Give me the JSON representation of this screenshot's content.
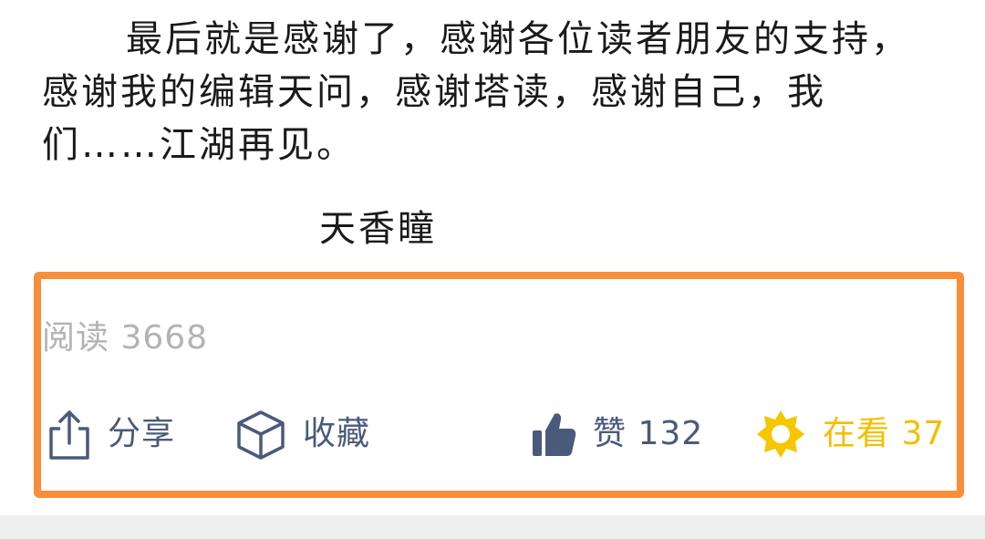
{
  "article": {
    "paragraph": "最后就是感谢了，感谢各位读者朋友的支持，感谢我的编辑天问，感谢塔读，感谢自己，我们……江湖再见。",
    "signature": "天香瞳"
  },
  "stats": {
    "read_label": "阅读 3668"
  },
  "actions": {
    "share_label": "分享",
    "collect_label": "收藏",
    "like_label": "赞 132",
    "watching_label": "在看 37"
  },
  "icons": {
    "share": "share-icon",
    "collect": "cube-icon",
    "like": "thumbs-up-icon",
    "watching": "watching-icon"
  },
  "colors": {
    "highlight_border": "#f98e3a",
    "action_text": "#4a5a7b",
    "watching_accent": "#f0c000",
    "read_count": "#b3b3b3"
  }
}
